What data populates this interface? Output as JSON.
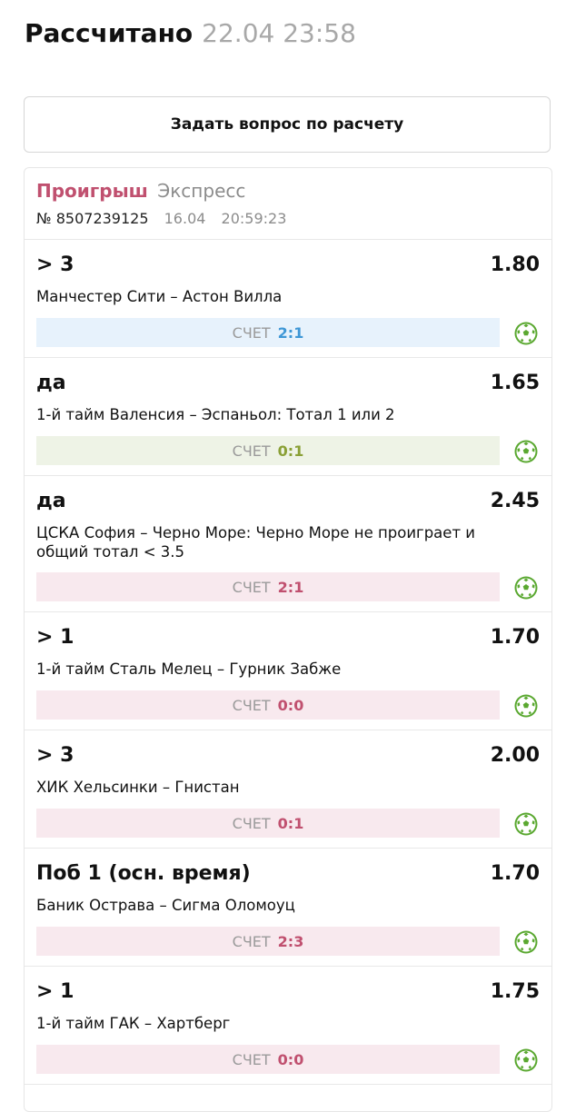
{
  "header": {
    "title": "Рассчитано",
    "datetime": "22.04 23:58"
  },
  "ask_button": {
    "label": "Задать вопрос по расчету"
  },
  "bet": {
    "status": "Проигрыш",
    "type": "Экспресс",
    "number": "№ 8507239125",
    "date": "16.04",
    "time": "20:59:23"
  },
  "colors": {
    "loss": "#c0506f",
    "win_score": "#3f97d6",
    "draw_score": "#8aa036",
    "football_icon": "#5aa830"
  },
  "events": [
    {
      "outcome": "> 3",
      "odds": "1.80",
      "match": "Манчестер Сити – Астон Вилла",
      "score_label": "СЧЕТ",
      "score": "2:1",
      "icon": "football-icon"
    },
    {
      "outcome": "да",
      "odds": "1.65",
      "match": "1-й тайм Валенсия – Эспаньол: Тотал 1 или 2",
      "score_label": "СЧЕТ",
      "score": "0:1",
      "icon": "football-icon"
    },
    {
      "outcome": "да",
      "odds": "2.45",
      "match": "ЦСКА София – Черно Море: Черно Море не проиграет и общий тотал < 3.5",
      "score_label": "СЧЕТ",
      "score": "2:1",
      "icon": "football-icon"
    },
    {
      "outcome": "> 1",
      "odds": "1.70",
      "match": "1-й тайм Сталь Мелец – Гурник Забже",
      "score_label": "СЧЕТ",
      "score": "0:0",
      "icon": "football-icon"
    },
    {
      "outcome": "> 3",
      "odds": "2.00",
      "match": "ХИК Хельсинки – Гнистан",
      "score_label": "СЧЕТ",
      "score": "0:1",
      "icon": "football-icon"
    },
    {
      "outcome": "Поб 1 (осн. время)",
      "odds": "1.70",
      "match": "Баник Острава – Сигма Оломоуц",
      "score_label": "СЧЕТ",
      "score": "2:3",
      "icon": "football-icon"
    },
    {
      "outcome": "> 1",
      "odds": "1.75",
      "match": "1-й тайм ГАК – Хартберг",
      "score_label": "СЧЕТ",
      "score": "0:0",
      "icon": "football-icon"
    }
  ]
}
